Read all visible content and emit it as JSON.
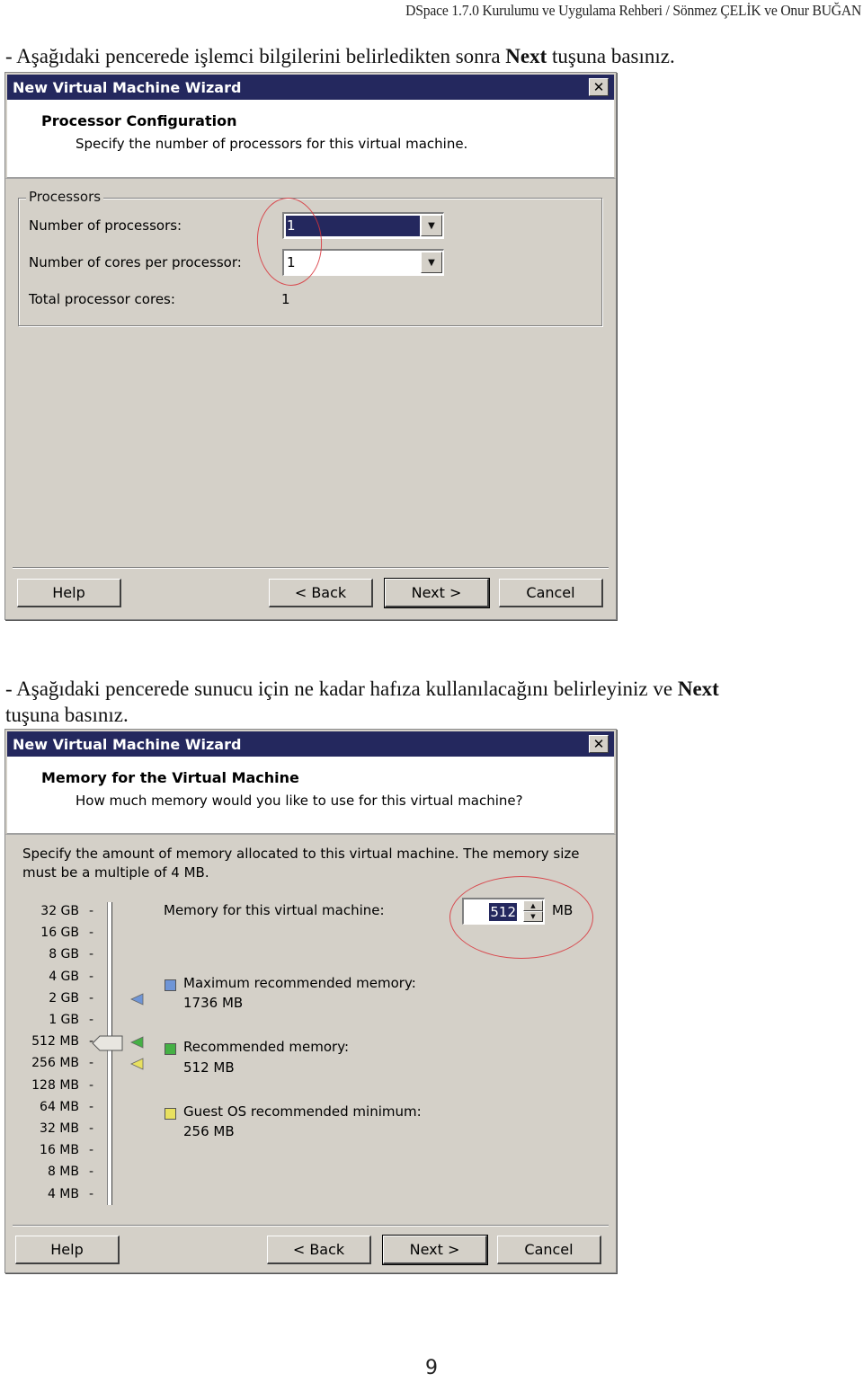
{
  "running_header": "DSpace 1.7.0  Kurulumu ve Uygulama Rehberi / Sönmez ÇELİK ve Onur BUĞAN",
  "instruction1": {
    "before": "- Aşağıdaki pencerede işlemci bilgilerini belirledikten sonra ",
    "bold": "Next",
    "after": " tuşuna basınız."
  },
  "instruction2": {
    "before": "- Aşağıdaki pencerede sunucu için ne kadar hafıza kullanılacağını belirleyiniz ve ",
    "bold": "Next",
    "after_line2": "tuşuna basınız."
  },
  "page_number": "9",
  "colors": {
    "titlebar": "#24285e",
    "dialog_bg": "#d4d0c8",
    "highlight_ellipse": "#d8333a",
    "max_memory_marker": "#6f95d6",
    "recommended_marker": "#45b045",
    "guest_min_marker": "#e8e060"
  },
  "wizard1": {
    "title": "New Virtual Machine Wizard",
    "close_icon": "close-x",
    "heading": "Processor Configuration",
    "subheading": "Specify the number of processors for this virtual machine.",
    "group_label": "Processors",
    "num_processors_label": "Number of processors:",
    "num_processors_value": "1",
    "cores_label": "Number of cores per processor:",
    "cores_value": "1",
    "total_label": "Total processor cores:",
    "total_value": "1",
    "buttons": {
      "help": "Help",
      "back": "< Back",
      "next": "Next >",
      "cancel": "Cancel"
    }
  },
  "wizard2": {
    "title": "New Virtual Machine Wizard",
    "close_icon": "close-x",
    "heading": "Memory for the Virtual Machine",
    "subheading": "How much memory would you like to use for this virtual machine?",
    "description_line1": "Specify the amount of memory allocated to this virtual machine. The memory size",
    "description_line2": "must be a multiple of 4 MB.",
    "memory_label": "Memory for this virtual machine:",
    "memory_value": "512",
    "memory_unit": "MB",
    "slider_ticks": [
      "32 GB",
      "16 GB",
      "8 GB",
      "4 GB",
      "2 GB",
      "1 GB",
      "512 MB",
      "256 MB",
      "128 MB",
      "64 MB",
      "32 MB",
      "16 MB",
      "8 MB",
      "4 MB"
    ],
    "slider_value": "512 MB",
    "legend": [
      {
        "label": "Maximum recommended memory:",
        "value": "1736 MB",
        "marker_at": "2 GB"
      },
      {
        "label": "Recommended memory:",
        "value": "512 MB",
        "marker_at": "512 MB"
      },
      {
        "label": "Guest OS recommended minimum:",
        "value": "256 MB",
        "marker_at": "256 MB"
      }
    ],
    "buttons": {
      "help": "Help",
      "back": "< Back",
      "next": "Next >",
      "cancel": "Cancel"
    }
  }
}
